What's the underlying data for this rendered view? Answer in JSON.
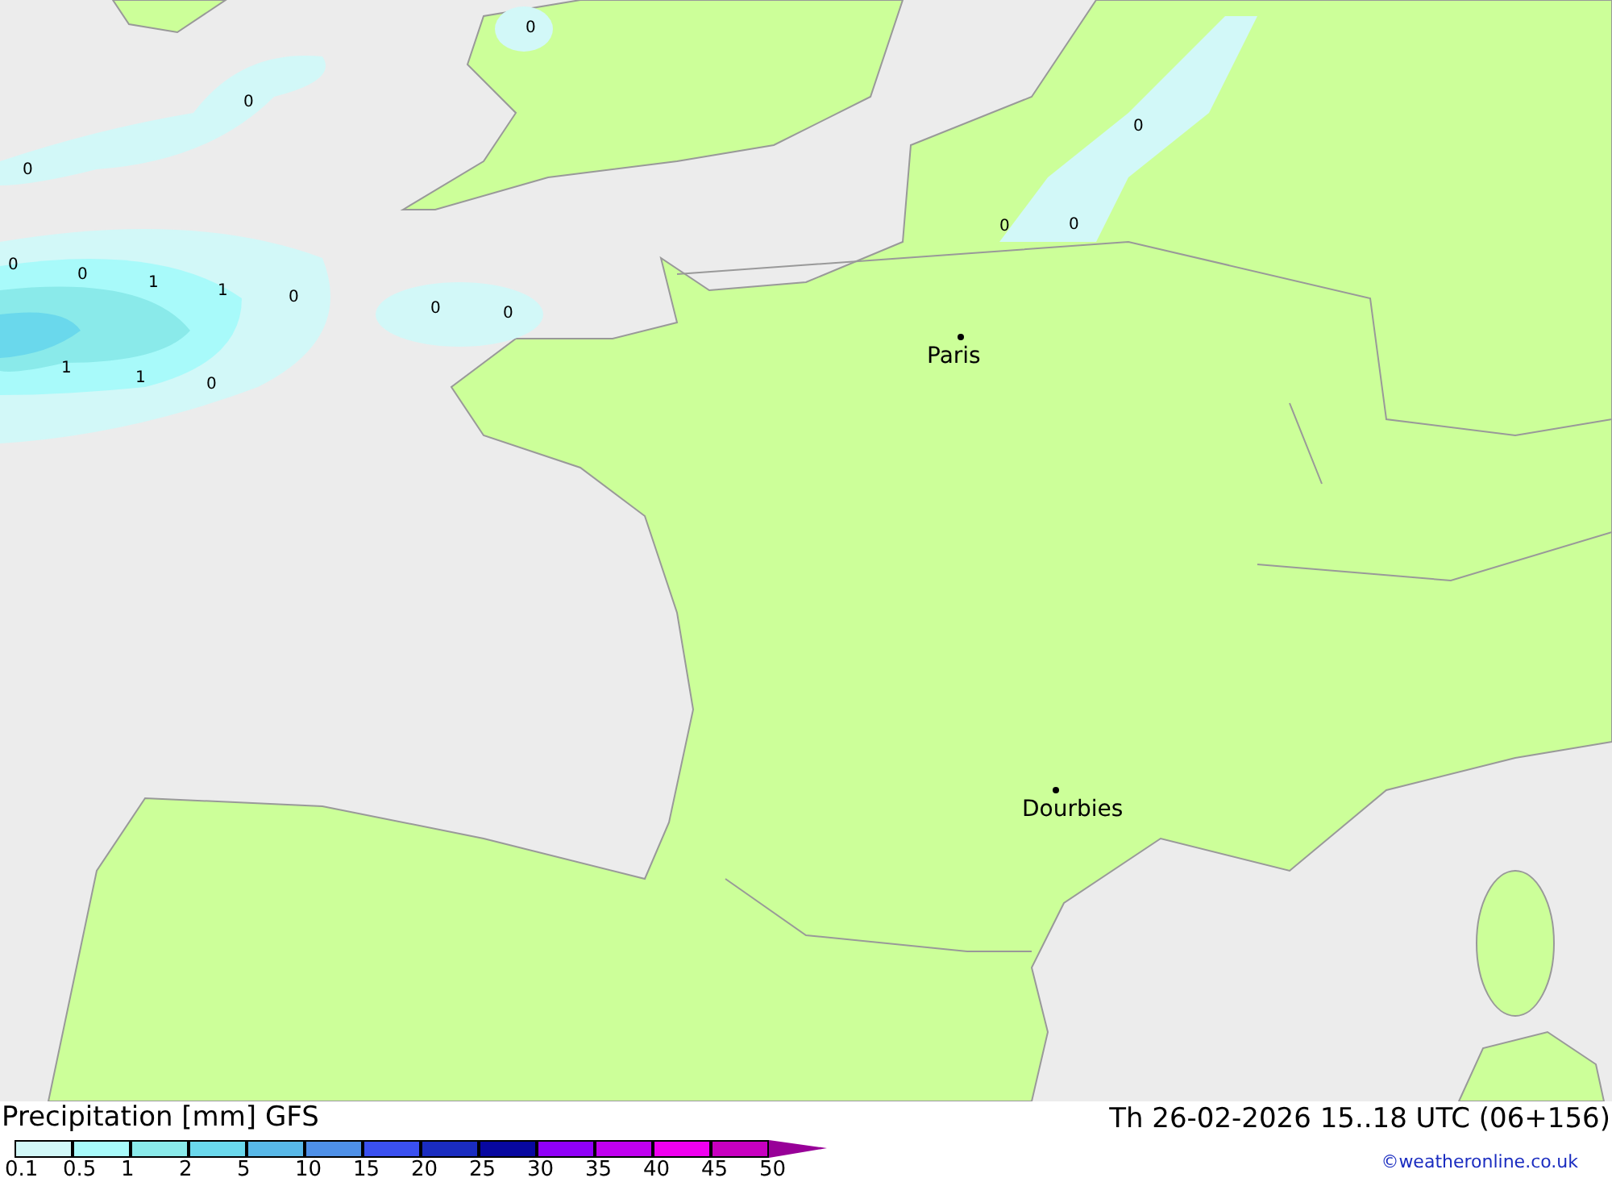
{
  "map": {
    "contour_labels": [
      "0",
      "0",
      "0",
      "0",
      "0",
      "1",
      "1",
      "0",
      "0",
      "0",
      "1",
      "1",
      "0",
      "0",
      "0",
      "0"
    ],
    "cities": [
      {
        "name": "Paris"
      },
      {
        "name": "Dourbies"
      }
    ]
  },
  "legend": {
    "title": "Precipitation [mm] GFS",
    "valid_time": "Th 26-02-2026 15..18 UTC (06+156)",
    "credit": "©weatheronline.co.uk",
    "steps": [
      {
        "label": "0.1",
        "color": "#d2f8f8"
      },
      {
        "label": "0.5",
        "color": "#a8fafa"
      },
      {
        "label": "1",
        "color": "#8aeaea"
      },
      {
        "label": "2",
        "color": "#6ad8ec"
      },
      {
        "label": "5",
        "color": "#58b8e8"
      },
      {
        "label": "10",
        "color": "#4e90e8"
      },
      {
        "label": "15",
        "color": "#3a50f0"
      },
      {
        "label": "20",
        "color": "#1a2cc0"
      },
      {
        "label": "25",
        "color": "#0808a0"
      },
      {
        "label": "30",
        "color": "#9000f8"
      },
      {
        "label": "35",
        "color": "#c000f0"
      },
      {
        "label": "40",
        "color": "#f000f0"
      },
      {
        "label": "45",
        "color": "#c800c0"
      },
      {
        "label": "50",
        "color": "#980098"
      }
    ]
  }
}
